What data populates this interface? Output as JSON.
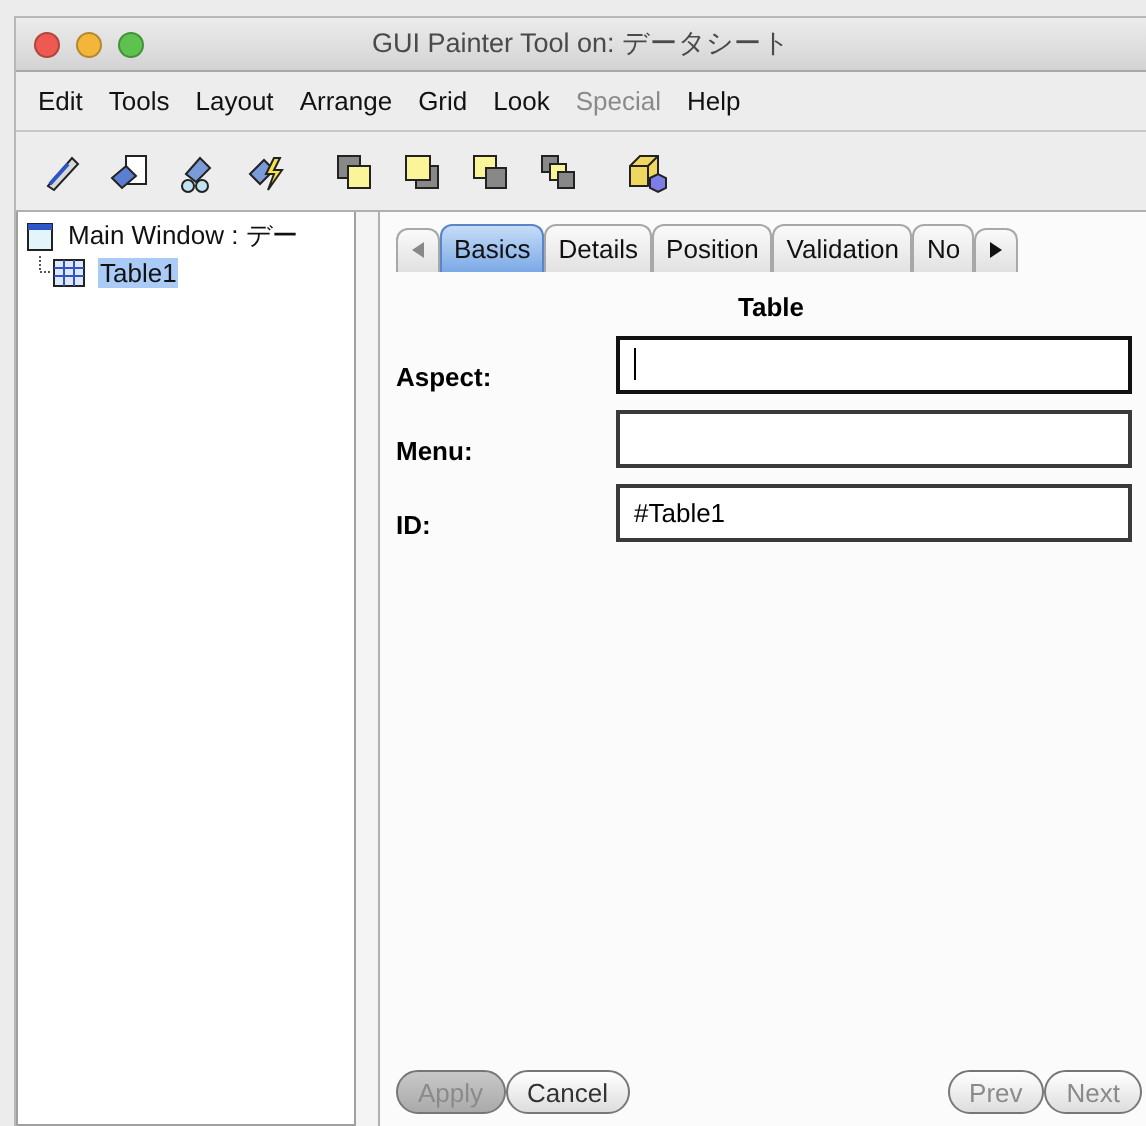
{
  "window": {
    "title": "GUI Painter Tool on: データシート"
  },
  "menu": [
    {
      "label": "Edit",
      "disabled": false
    },
    {
      "label": "Tools",
      "disabled": false
    },
    {
      "label": "Layout",
      "disabled": false
    },
    {
      "label": "Arrange",
      "disabled": false
    },
    {
      "label": "Grid",
      "disabled": false
    },
    {
      "label": "Look",
      "disabled": false
    },
    {
      "label": "Special",
      "disabled": true
    },
    {
      "label": "Help",
      "disabled": false
    }
  ],
  "toolbar": [
    {
      "kind": "pen"
    },
    {
      "kind": "paste"
    },
    {
      "kind": "glasses"
    },
    {
      "kind": "bolt"
    },
    {
      "kind": "front"
    },
    {
      "kind": "back"
    },
    {
      "kind": "forward"
    },
    {
      "kind": "backward"
    },
    {
      "kind": "cube"
    }
  ],
  "tree": [
    {
      "label": "Main Window : デー",
      "selected": false,
      "children": [
        {
          "label": "Table1",
          "selected": true
        }
      ]
    }
  ],
  "tabs": [
    {
      "label": "Basics",
      "selected": true
    },
    {
      "label": "Details",
      "selected": false
    },
    {
      "label": "Position",
      "selected": false
    },
    {
      "label": "Validation",
      "selected": false
    },
    {
      "label": "No",
      "selected": false
    }
  ],
  "section_title": "Table",
  "fields": [
    {
      "label": "Aspect:",
      "focused": true
    },
    {
      "label": "Menu:",
      "focused": false
    },
    {
      "label": "ID:",
      "value": "#Table1",
      "focused": false
    }
  ],
  "buttons": [
    {
      "label": "Apply",
      "disabled": true,
      "pressed": true
    },
    {
      "label": "Cancel",
      "disabled": false,
      "pressed": false
    },
    {
      "label": "Prev",
      "disabled": true,
      "pressed": false
    },
    {
      "label": "Next",
      "disabled": true,
      "pressed": false
    }
  ]
}
